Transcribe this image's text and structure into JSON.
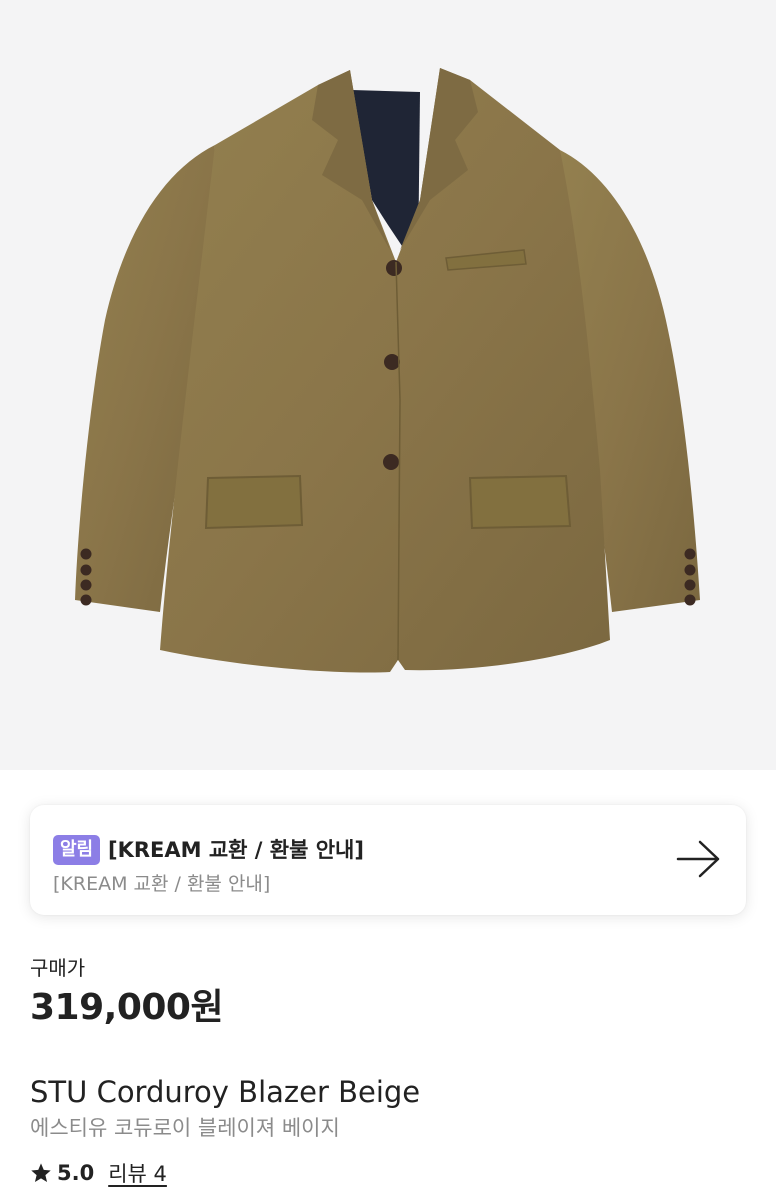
{
  "product_image": {
    "icon": "blazer-product-image",
    "jacket_color": "#8a7549"
  },
  "notice": {
    "badge": "알림",
    "title": "[KREAM 교환 / 환불 안내]",
    "subtitle": "[KREAM 교환 / 환불 안내]",
    "icon": "arrow-right-icon",
    "badge_color": "#8c7ee6"
  },
  "pricing": {
    "label": "구매가",
    "price": "319,000원"
  },
  "product": {
    "name_en": "STU Corduroy Blazer Beige",
    "name_ko": "에스티유 코듀로이 블레이져 베이지"
  },
  "rating": {
    "icon": "star-icon",
    "value": "5.0",
    "review_link": "리뷰 4"
  }
}
